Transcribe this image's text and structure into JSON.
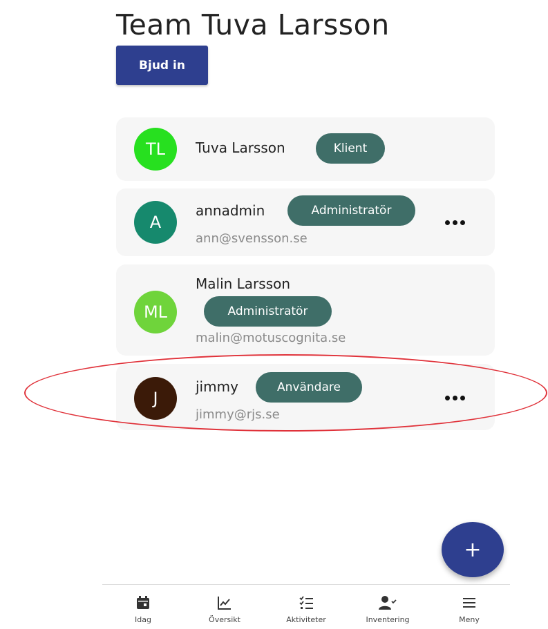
{
  "page": {
    "title": "Team Tuva Larsson",
    "invite_label": "Bjud in"
  },
  "members": [
    {
      "initials": "TL",
      "avatar_color": "#27e01f",
      "name": "Tuva Larsson",
      "role": "Klient",
      "email": ""
    },
    {
      "initials": "A",
      "avatar_color": "#16896d",
      "name": "annadmin",
      "role": "Administratör",
      "email": "ann@svensson.se",
      "menu": "•••"
    },
    {
      "initials": "ML",
      "avatar_color": "#6fd43b",
      "name": "Malin Larsson",
      "role": "Administratör",
      "email": "malin@motuscognita.se"
    },
    {
      "initials": "J",
      "avatar_color": "#3b1a08",
      "name": "jimmy",
      "role": "Användare",
      "email": "jimmy@rjs.se",
      "menu": "•••"
    }
  ],
  "fab": {
    "label": "+"
  },
  "bottom_nav": [
    {
      "label": "Idag",
      "icon": "calendar-icon"
    },
    {
      "label": "Översikt",
      "icon": "chart-icon"
    },
    {
      "label": "Aktiviteter",
      "icon": "checklist-icon"
    },
    {
      "label": "Inventering",
      "icon": "person-check-icon"
    },
    {
      "label": "Meny",
      "icon": "menu-icon"
    }
  ],
  "colors": {
    "primary": "#2e3f8f",
    "badge": "#3f6e68",
    "highlight": "#e0323a"
  }
}
